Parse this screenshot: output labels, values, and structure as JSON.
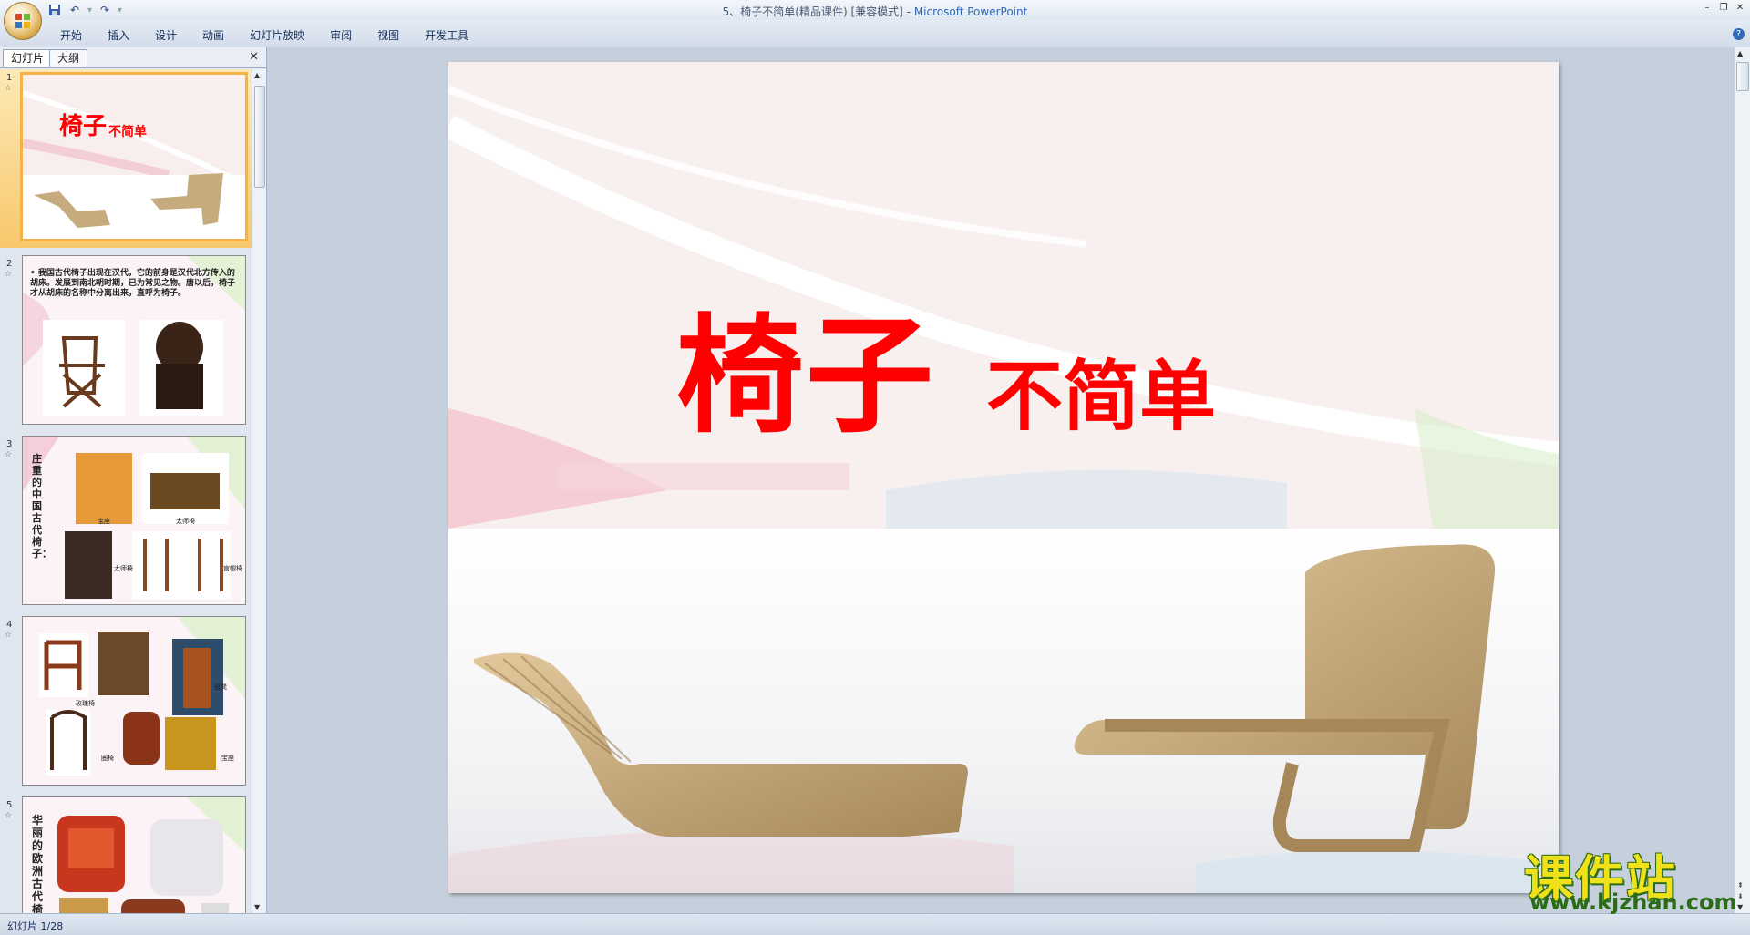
{
  "window": {
    "title_doc": "5、椅子不简单(精品课件) [兼容模式]",
    "title_sep": " - ",
    "title_app": "Microsoft PowerPoint"
  },
  "ribbon": {
    "tabs": [
      "开始",
      "插入",
      "设计",
      "动画",
      "幻灯片放映",
      "审阅",
      "视图",
      "开发工具"
    ]
  },
  "left_pane": {
    "tab_slides": "幻灯片",
    "tab_outline": "大纲",
    "slides": [
      {
        "num": "1",
        "title": "椅子",
        "subtitle": "不简单"
      },
      {
        "num": "2",
        "text": "• 我国古代椅子出现在汉代，它的前身是汉代北方传入的胡床。发展到南北朝时期，已为常见之物。唐以后，椅子才从胡床的名称中分离出来，直呼为椅子。"
      },
      {
        "num": "3",
        "side": "庄重的中国古代椅子：",
        "captions": [
          "宝座",
          "太师椅",
          "太师椅",
          "官帽椅"
        ]
      },
      {
        "num": "4",
        "captions": [
          "玫瑰椅",
          "圈椅",
          "鼓凳",
          "宝座"
        ]
      },
      {
        "num": "5",
        "side": "华丽的欧洲古代椅子"
      }
    ]
  },
  "slide": {
    "title_big": "椅子",
    "title_small": "不简单"
  },
  "status": {
    "slide_counter": "幻灯片 1/28"
  },
  "watermark": {
    "cn": "课件站",
    "url": "www.kjzhan.com"
  },
  "colors": {
    "title_red": "#ff0000",
    "selection_orange": "#f3b24a",
    "watermark_yellow": "#f0e11a",
    "watermark_green": "#2a6c18"
  }
}
